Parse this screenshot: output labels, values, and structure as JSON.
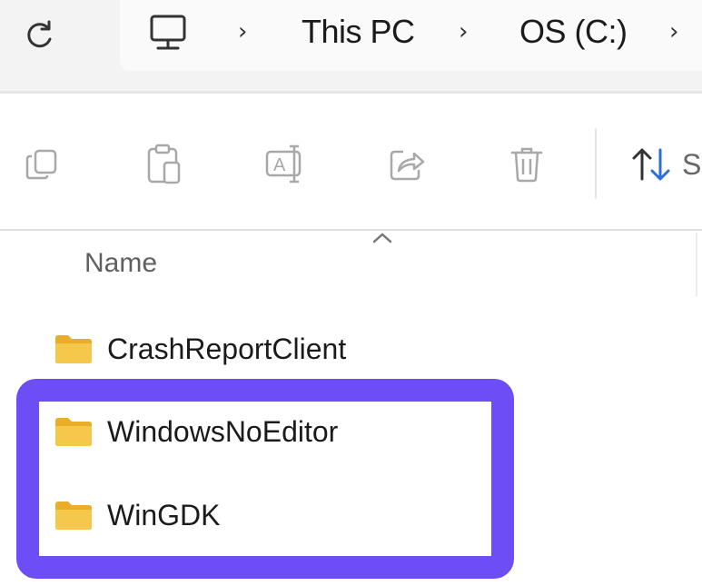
{
  "address_bar": {
    "refresh_icon": "refresh-icon",
    "location_icon": "this-pc-icon",
    "breadcrumbs": [
      "This PC",
      "OS (C:)"
    ]
  },
  "command_bar": {
    "buttons": [
      "copy-icon",
      "paste-icon",
      "rename-icon",
      "share-icon",
      "delete-icon"
    ],
    "sort_icon": "sort-icon",
    "sort_label": "S"
  },
  "file_list": {
    "column_header": "Name",
    "items": [
      {
        "name": "CrashReportClient",
        "type": "folder"
      },
      {
        "name": "WindowsNoEditor",
        "type": "folder"
      },
      {
        "name": "WinGDK",
        "type": "folder"
      }
    ]
  },
  "colors": {
    "highlight": "#6c4df6",
    "folder": "#f5c84c",
    "accent": "#2b6fd6"
  }
}
